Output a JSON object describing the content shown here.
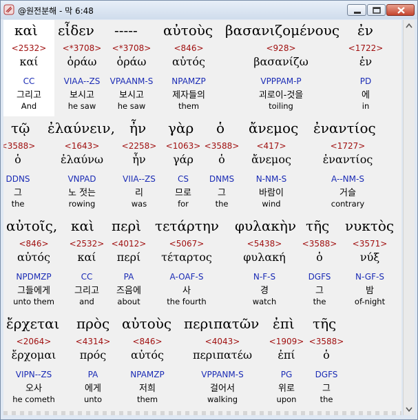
{
  "window": {
    "title": "@원전분해 - 막 6:48"
  },
  "lines": [
    {
      "words": [
        "καὶ",
        "εἶδεν",
        "-----",
        "αὐτοὺς",
        "βασανιζομένους",
        "ἐν"
      ],
      "entries": [
        {
          "num": "<2532>",
          "lex": "καί",
          "pars": "CC",
          "kor": "그리고",
          "eng": "And"
        },
        {
          "num": "<*3708>",
          "lex": "ὁράω",
          "pars": "VIAA--ZS",
          "kor": "보시고",
          "eng": "he saw"
        },
        {
          "num": "<*3708>",
          "lex": "ὁράω",
          "pars": "VPAANM-S",
          "kor": "보시고",
          "eng": "he saw"
        },
        {
          "num": "<846>",
          "lex": "αὐτός",
          "pars": "NPAMZP",
          "kor": "제자들의",
          "eng": "them"
        },
        {
          "num": "<928>",
          "lex": "βασανίζω",
          "pars": "VPPPAM-P",
          "kor": "괴로이-것을",
          "eng": "toiling"
        },
        {
          "num": "<1722>",
          "lex": "ἐν",
          "pars": "PD",
          "kor": "에",
          "eng": "in"
        }
      ]
    },
    {
      "words": [
        "τῷ",
        "ἐλαύνειν,",
        "ἦν",
        "γὰρ",
        "ὁ",
        "ἄνεμος",
        "ἐναντίος"
      ],
      "entries": [
        {
          "num": "<3588>",
          "lex": "ὁ",
          "pars": "DDNS",
          "kor": "그",
          "eng": "the"
        },
        {
          "num": "<1643>",
          "lex": "ἐλαύνω",
          "pars": "VNPAD",
          "kor": "노 젓는",
          "eng": "rowing"
        },
        {
          "num": "<2258>",
          "lex": "ἦν",
          "pars": "VIIA--ZS",
          "kor": "리",
          "eng": "was"
        },
        {
          "num": "<1063>",
          "lex": "γάρ",
          "pars": "CS",
          "kor": "므로",
          "eng": "for"
        },
        {
          "num": "<3588>",
          "lex": "ὁ",
          "pars": "DNMS",
          "kor": "그",
          "eng": "the"
        },
        {
          "num": "<417>",
          "lex": "ἄνεμος",
          "pars": "N-NM-S",
          "kor": "바람이",
          "eng": "wind"
        },
        {
          "num": "<1727>",
          "lex": "ἐναντίος",
          "pars": "A--NM-S",
          "kor": "거슬",
          "eng": "contrary"
        }
      ]
    },
    {
      "words": [
        "αὐτοῖς,",
        "καὶ",
        "περὶ",
        "τετάρτην",
        "φυλακὴν",
        "τῆς",
        "νυκτὸς"
      ],
      "entries": [
        {
          "num": "<846>",
          "lex": "αὐτός",
          "pars": "NPDMZP",
          "kor": "그들에게",
          "eng": "unto them"
        },
        {
          "num": "<2532>",
          "lex": "καί",
          "pars": "CC",
          "kor": "그리고",
          "eng": "and"
        },
        {
          "num": "<4012>",
          "lex": "περί",
          "pars": "PA",
          "kor": "즈음에",
          "eng": "about"
        },
        {
          "num": "<5067>",
          "lex": "τέταρτος",
          "pars": "A-OAF-S",
          "kor": "사",
          "eng": "the fourth"
        },
        {
          "num": "<5438>",
          "lex": "φυλακή",
          "pars": "N-F-S",
          "kor": "경",
          "eng": "watch"
        },
        {
          "num": "<3588>",
          "lex": "ὁ",
          "pars": "DGFS",
          "kor": "그",
          "eng": "the"
        },
        {
          "num": "<3571>",
          "lex": "νύξ",
          "pars": "N-GF-S",
          "kor": "밤",
          "eng": "of-night"
        }
      ]
    },
    {
      "words": [
        "ἔρχεται",
        "πρὸς",
        "αὐτοὺς",
        "περιπατῶν",
        "ἐπὶ",
        "τῆς"
      ],
      "entries": [
        {
          "num": "<2064>",
          "lex": "ἔρχομαι",
          "pars": "VIPN--ZS",
          "kor": "오사",
          "eng": "he cometh"
        },
        {
          "num": "<4314>",
          "lex": "πρός",
          "pars": "PA",
          "kor": "에게",
          "eng": "unto"
        },
        {
          "num": "<846>",
          "lex": "αὐτός",
          "pars": "NPAMZP",
          "kor": "저희",
          "eng": "them"
        },
        {
          "num": "<4043>",
          "lex": "περιπατέω",
          "pars": "VPPANM-S",
          "kor": "걸어서",
          "eng": "walking"
        },
        {
          "num": "<1909>",
          "lex": "ἐπί",
          "pars": "PG",
          "kor": "위로",
          "eng": "upon"
        },
        {
          "num": "<3588>",
          "lex": "ὁ",
          "pars": "DGFS",
          "kor": "그",
          "eng": "the"
        }
      ]
    }
  ]
}
